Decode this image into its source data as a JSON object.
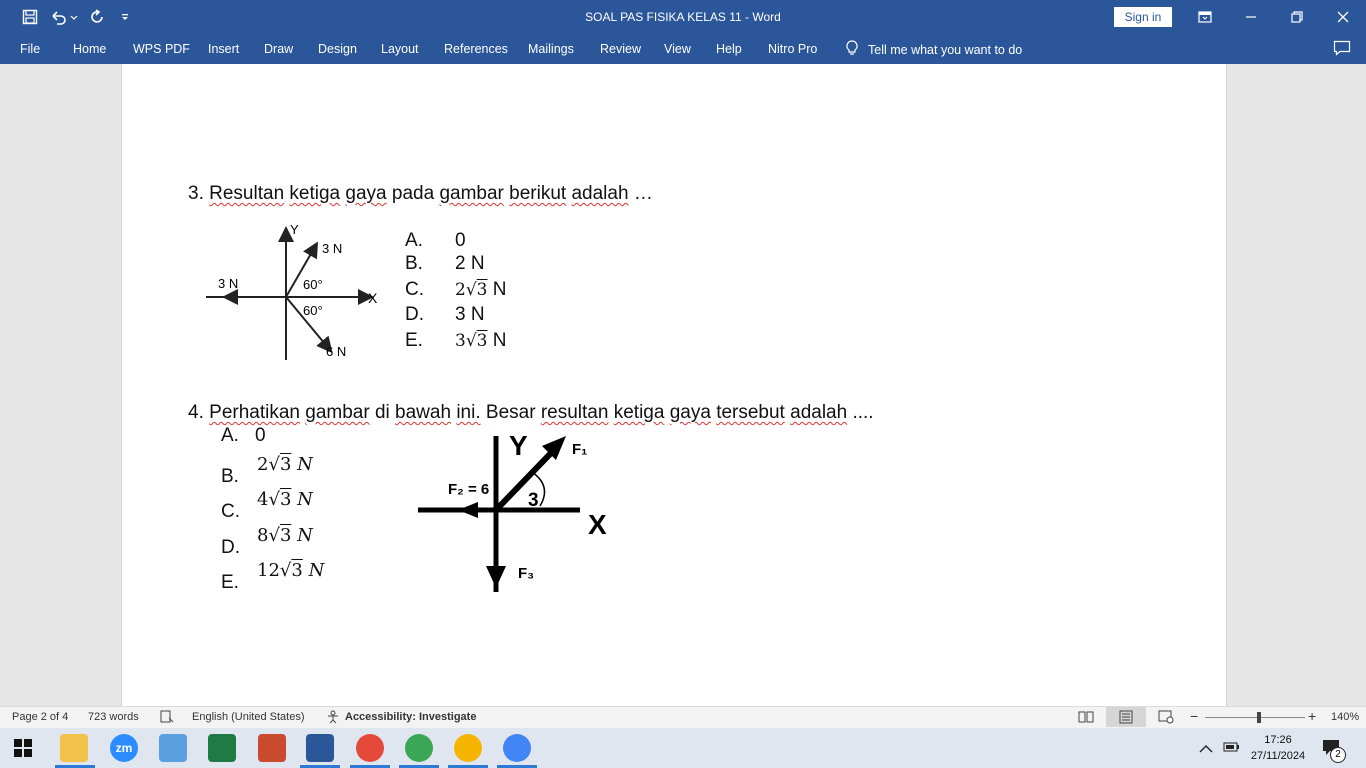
{
  "titlebar": {
    "title": "SOAL PAS FISIKA KELAS 11  -  Word",
    "sign_in": "Sign in"
  },
  "ribbon": {
    "tabs": [
      "File",
      "Home",
      "WPS PDF",
      "Insert",
      "Draw",
      "Design",
      "Layout",
      "References",
      "Mailings",
      "Review",
      "View",
      "Help",
      "Nitro Pro"
    ],
    "tell_me": "Tell me what you want to do"
  },
  "document": {
    "q3": {
      "number": "3.",
      "words": [
        "Resultan",
        "ketiga",
        "gaya",
        "pada",
        "gambar",
        "berikut",
        "adalah",
        "…"
      ],
      "options": [
        {
          "letter": "A.",
          "text": "0"
        },
        {
          "letter": "B.",
          "text": "2 N"
        },
        {
          "letter": "C.",
          "coef": "2",
          "root": "3",
          "unit": "N"
        },
        {
          "letter": "D.",
          "text": "3 N"
        },
        {
          "letter": "E.",
          "coef": "3",
          "root": "3",
          "unit": "N"
        }
      ],
      "figure": {
        "y_label": "Y",
        "x_label": "X",
        "f_up": "3 N",
        "f_left": "3 N",
        "f_down": "6 N",
        "angle_top": "60°",
        "angle_bottom": "60°"
      }
    },
    "q4": {
      "number": "4.",
      "words": [
        "Perhatikan",
        "gambar",
        "di",
        "bawah",
        "ini.",
        "Besar",
        "resultan",
        "ketiga",
        "gaya",
        "tersebut",
        "adalah",
        "...."
      ],
      "options": [
        {
          "letter": "A.",
          "text": "0"
        },
        {
          "letter": "B.",
          "coef": "2",
          "root": "3",
          "unit": "N"
        },
        {
          "letter": "C.",
          "coef": "4",
          "root": "3",
          "unit": "N"
        },
        {
          "letter": "D.",
          "coef": "8",
          "root": "3",
          "unit": "N"
        },
        {
          "letter": "E.",
          "coef": "12",
          "root": "3",
          "unit": "N"
        }
      ],
      "figure": {
        "y_label": "Y",
        "x_label": "X",
        "f1": "F₁",
        "f2": "F₂ = 6",
        "f3": "F₃",
        "angle": "3"
      }
    }
  },
  "statusbar": {
    "page": "Page 2 of 4",
    "words": "723 words",
    "language": "English (United States)",
    "accessibility": "Accessibility: Investigate",
    "zoom": "140%"
  },
  "taskbar": {
    "time": "17:26",
    "date": "27/11/2024",
    "notifications": "2",
    "zoom_app": "zm"
  },
  "colors": {
    "word_blue": "#2b579a",
    "spell_squiggle": "#d33"
  }
}
